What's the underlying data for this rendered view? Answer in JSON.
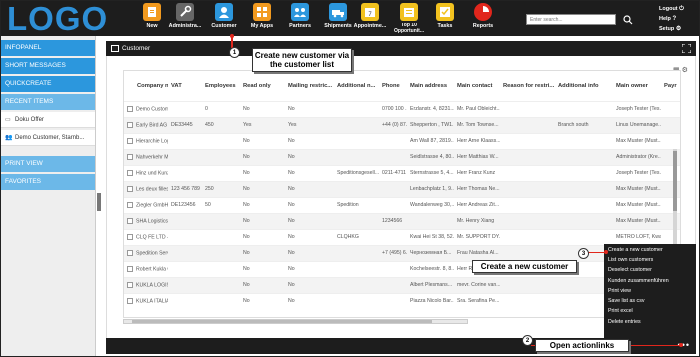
{
  "brand": {
    "logo_text": "LOGO",
    "accent": "#2c97dd",
    "topbar_bg": "#1d1d1d"
  },
  "nav": [
    {
      "label": "New",
      "icon": "new-document-icon",
      "color": "#f29a1f"
    },
    {
      "label": "Administra...",
      "icon": "wrench-icon",
      "color": "#666666"
    },
    {
      "label": "Customer",
      "icon": "customer-icon",
      "color": "#2c97dd"
    },
    {
      "label": "My Apps",
      "icon": "apps-grid-icon",
      "color": "#f29a1f"
    },
    {
      "label": "Partners",
      "icon": "partners-icon",
      "color": "#2c97dd"
    },
    {
      "label": "Shipments",
      "icon": "shipment-icon",
      "color": "#2c97dd"
    },
    {
      "label": "Appointme...",
      "icon": "calendar-icon",
      "color": "#f2c21f"
    },
    {
      "label": "Top 10 Opportunit...",
      "icon": "top10-icon",
      "color": "#f2c21f"
    },
    {
      "label": "Tasks",
      "icon": "tasks-icon",
      "color": "#f2c21f"
    },
    {
      "label": "Reports",
      "icon": "reports-icon",
      "color": "#e1261c"
    }
  ],
  "search": {
    "placeholder": "Enter search..."
  },
  "user_links": {
    "logout": "Logout",
    "help": "Help",
    "setup": "Setup"
  },
  "sidebar": {
    "sections": [
      {
        "label": "INFOPANEL"
      },
      {
        "label": "SHORT MESSAGES"
      },
      {
        "label": "QUICKCREATE"
      },
      {
        "label": "RECENT ITEMS"
      }
    ],
    "recent_items": [
      {
        "label": "Doku Offer",
        "icon": "document-icon"
      },
      {
        "label": "Demo Customer, Starnb...",
        "icon": "people-icon"
      }
    ],
    "sections_bottom": [
      {
        "label": "PRINT VIEW"
      },
      {
        "label": "FAVORITES"
      }
    ]
  },
  "panel": {
    "title": "Customer"
  },
  "table": {
    "columns": [
      "Company na...",
      "VAT",
      "Employees",
      "Read only",
      "Mailing restric...",
      "Additional n...",
      "Phone",
      "Main address",
      "Main contact",
      "Reason for restri...",
      "Additional info",
      "Main owner",
      "Payr"
    ],
    "rows": [
      [
        "Demo Customer",
        "",
        "0",
        "No",
        "No",
        "",
        "0700 100 ...",
        "Erzlanstr. 4, 8231...",
        "Mr. Paul Obleicht...",
        "",
        "",
        "Joseph Tester (Tes...",
        ""
      ],
      [
        "Early Bird AG",
        "DE33445",
        "450",
        "Yes",
        "Yes",
        "",
        "+44 (0) 87...",
        "Shepperton , TW1...",
        "Mr. Tom Townse...",
        "",
        "Branch south",
        "Linus Unemanage...",
        ""
      ],
      [
        "Hierarchie Logi...",
        "",
        "",
        "No",
        "No",
        "",
        "",
        "Am Wall 87, 2819...",
        "Herr Arne Klaass...",
        "",
        "",
        "Max Muster (Must...",
        ""
      ],
      [
        "Nahverkehr Mu...",
        "",
        "",
        "No",
        "No",
        "",
        "",
        "Seidlstrasse 4, 80...",
        "Herr Matthias W...",
        "",
        "",
        "Administrator (Kre...",
        ""
      ],
      [
        "Hinz und Kunz ...",
        "",
        "",
        "No",
        "No",
        "Speditionsgesell...",
        "0211-4711",
        "Sternstrasse 5, 4...",
        "Herr Franz Kunz",
        "",
        "",
        "Joseph Tester (Tes...",
        ""
      ],
      [
        "Les deux filles",
        "123 456 789",
        "250",
        "No",
        "No",
        "",
        "",
        "Lenbachplatz 1, 9...",
        "Herr Thomas Ne...",
        "",
        "",
        "Max Muster (Must...",
        ""
      ],
      [
        "Ziegler GmbH",
        "DE123456",
        "50",
        "No",
        "No",
        "Spedition",
        "",
        "Wandalenweg 30,...",
        "Herr Andreas Zit...",
        "",
        "",
        "Max Muster (Must...",
        ""
      ],
      [
        "SHA Logistics SA",
        "",
        "",
        "No",
        "No",
        "",
        "1234566",
        "",
        "Mr. Henry Xiang",
        "",
        "",
        "Max Muster (Must...",
        ""
      ],
      [
        "CLQ FE LTD - H...",
        "",
        "",
        "No",
        "No",
        "CLQHKG",
        "",
        "Kwai Hei St 38, 52...",
        "Mr. SUPPORT DY...",
        "",
        "",
        "METRO LOFT, Kwai...",
        ""
      ],
      [
        "Spedition Servi...",
        "",
        "",
        "No",
        "No",
        "",
        "+7 (495) 6...",
        "Черноземная Б...",
        "Frau Natasha Al...",
        "",
        "",
        "",
        ""
      ],
      [
        "Robert Kukla G...",
        "",
        "",
        "No",
        "No",
        "",
        "",
        "Kochelseestr. 8, 8...",
        "Herr Robert Kukl...",
        "",
        "",
        "",
        ""
      ],
      [
        "KUKLA LOGISTI...",
        "",
        "",
        "No",
        "No",
        "",
        "",
        "Albert Plesmans...",
        "mevr. Corine van...",
        "",
        "",
        "",
        ""
      ],
      [
        "KUKLA ITALIA S...",
        "",
        "",
        "No",
        "No",
        "",
        "",
        "Piazza Nicolo Bar...",
        "Sra. Serafina Pe...",
        "",
        "",
        "",
        ""
      ]
    ]
  },
  "action_menu": {
    "items": [
      "Create a new customer",
      "List own customers",
      "Deselect customer",
      "Kunden zusammenführen",
      "Print view",
      "Save list as csv",
      "Print excel",
      "Delete entries"
    ]
  },
  "footer": {
    "more_label": "•••"
  },
  "callouts": [
    {
      "number": "1",
      "text": "Create new customer via the customer list"
    },
    {
      "number": "2",
      "text": "Open actionlinks"
    },
    {
      "number": "3",
      "text": "Create a new customer"
    }
  ]
}
